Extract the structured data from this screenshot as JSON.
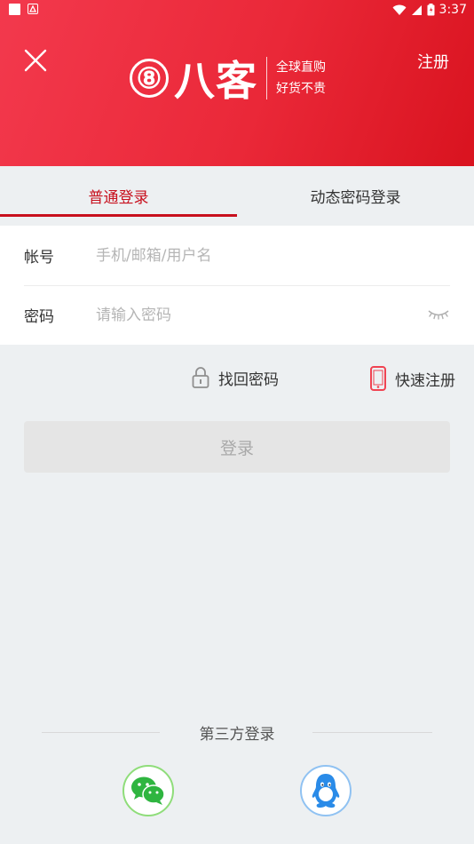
{
  "status_bar": {
    "time": "3:37"
  },
  "header": {
    "brand_number": "⑧",
    "brand_name": "八客",
    "slogan_line1": "全球直购",
    "slogan_line2": "好货不贵",
    "register_label": "注册"
  },
  "tabs": [
    {
      "label": "普通登录",
      "active": true
    },
    {
      "label": "动态密码登录",
      "active": false
    }
  ],
  "form": {
    "account_label": "帐号",
    "account_placeholder": "手机/邮箱/用户名",
    "account_value": "",
    "password_label": "密码",
    "password_placeholder": "请输入密码",
    "password_value": ""
  },
  "links": {
    "find_password": "找回密码",
    "quick_register": "快速注册"
  },
  "login_button": "登录",
  "third_party": {
    "title": "第三方登录",
    "providers": [
      "wechat",
      "qq"
    ]
  },
  "colors": {
    "header_start": "#f3394d",
    "header_end": "#d9131f",
    "accent": "#c8101e",
    "wechat": "#2fb540",
    "qq": "#2a8be8"
  }
}
